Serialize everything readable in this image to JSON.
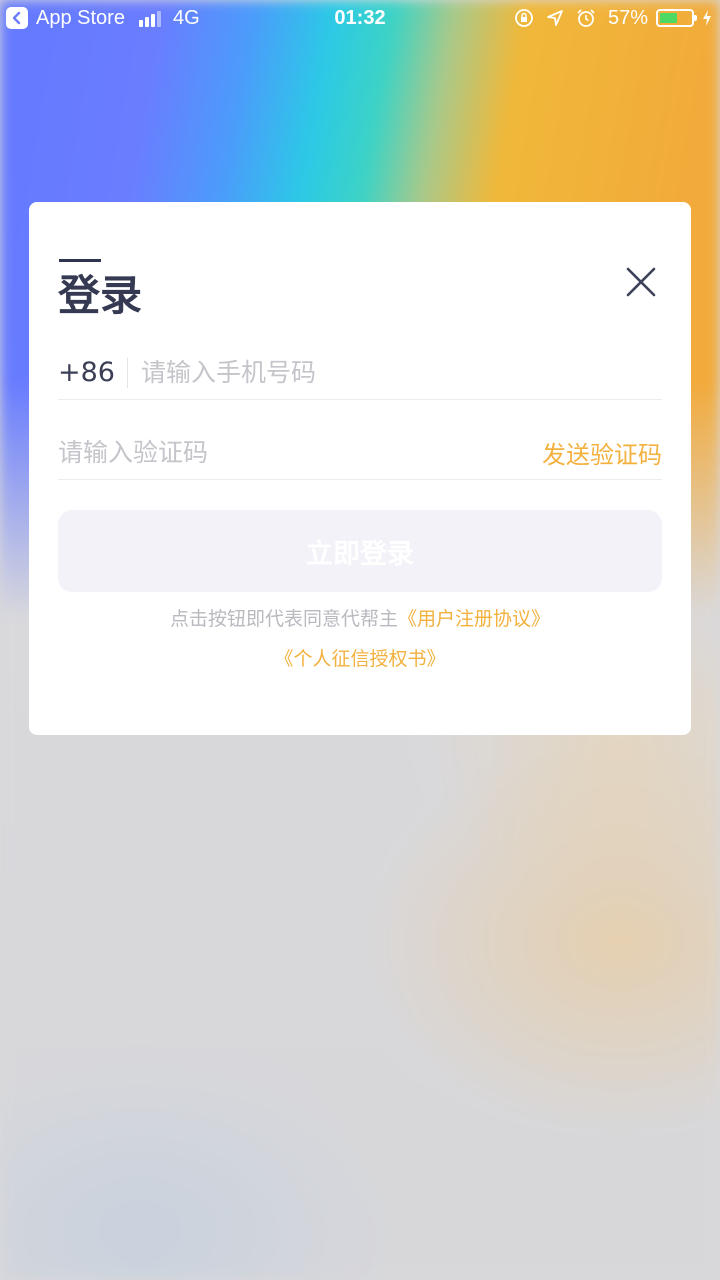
{
  "status_bar": {
    "back_app": "App Store",
    "network": "4G",
    "time": "01:32",
    "battery_percent_text": "57%",
    "battery_level": 0.57,
    "battery_color": "#4cd964"
  },
  "login": {
    "title": "登录",
    "country_code": "+86",
    "phone_placeholder": "请输入手机号码",
    "code_placeholder": "请输入验证码",
    "send_code_label": "发送验证码",
    "submit_label": "立即登录",
    "agreement_prefix": "点击按钮即代表同意代帮主",
    "user_agreement_link": "《用户注册协议》",
    "credit_auth_link": "《个人征信授权书》"
  },
  "colors": {
    "accent": "#f3b13e",
    "title": "#353a52",
    "button_bg": "#f2f2f8"
  },
  "icons": {
    "back": "chevron-left-icon",
    "close": "close-icon",
    "orientation_lock": "orientation-lock-icon",
    "location": "location-arrow-icon",
    "alarm": "alarm-clock-icon",
    "charging": "lightning-bolt-icon"
  }
}
